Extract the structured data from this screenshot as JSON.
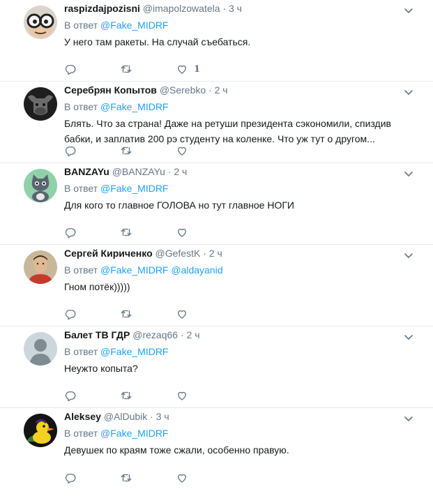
{
  "reply_prefix": "В ответ",
  "tweets": [
    {
      "name": "raspizdajpozisni",
      "handle": "@imapolzowatela",
      "dot": "·",
      "time": "3 ч",
      "mentions": [
        "@Fake_MIDRF"
      ],
      "text": "У него там ракеты. На случай съебаться.",
      "likes": "1",
      "avatar_icon": "glasses-avatar"
    },
    {
      "name": "Серебрян Копытов",
      "handle": "@Serebko",
      "dot": "·",
      "time": "2 ч",
      "mentions": [
        "@Fake_MIDRF"
      ],
      "text": "Блять. Что за страна! Даже на ретуши президента сэкономили, спиздив бабки, и заплатив 200 рэ студенту на коленке. Что уж тут о другом...",
      "likes": "",
      "avatar_icon": "bull-avatar"
    },
    {
      "name": "BANZAYu",
      "handle": "@BANZAYu",
      "dot": "·",
      "time": "2 ч",
      "mentions": [
        "@Fake_MIDRF"
      ],
      "text": "Для кого то главное ГОЛОВА но тут главное НОГИ",
      "likes": "",
      "avatar_icon": "cat-avatar"
    },
    {
      "name": "Сергей Кириченко",
      "handle": "@GefestK",
      "dot": "·",
      "time": "2 ч",
      "mentions": [
        "@Fake_MIDRF",
        "@aldayanid"
      ],
      "text": "Гном потёк)))))",
      "likes": "",
      "avatar_icon": "man-avatar"
    },
    {
      "name": "Балет ТВ ГДР",
      "handle": "@rezaq66",
      "dot": "·",
      "time": "2 ч",
      "mentions": [
        "@Fake_MIDRF"
      ],
      "text": "Неужто копыта?",
      "likes": "",
      "avatar_icon": "default-avatar"
    },
    {
      "name": "Aleksey",
      "handle": "@AlDubik",
      "dot": "·",
      "time": "3 ч",
      "mentions": [
        "@Fake_MIDRF"
      ],
      "text": "Девушек по краям тоже сжали, особенно правую.",
      "likes": "",
      "avatar_icon": "duck-avatar"
    }
  ]
}
